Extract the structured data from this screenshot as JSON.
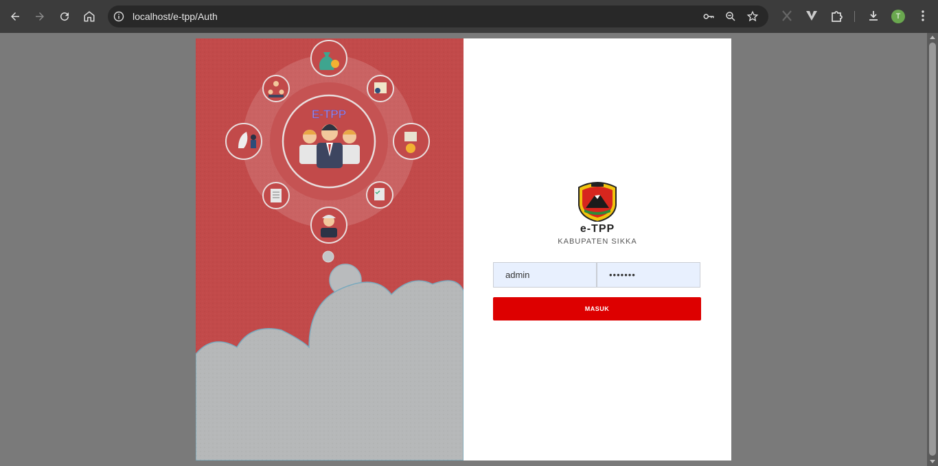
{
  "browser": {
    "url": "localhost/e-tpp/Auth",
    "profile_initial": "T",
    "icons": [
      "back-icon",
      "forward-icon",
      "reload-icon",
      "home-icon",
      "info-icon",
      "key-icon",
      "zoom-icon",
      "star-icon",
      "x-extension-icon",
      "vivaldi-extension-icon",
      "extensions-puzzle-icon",
      "download-icon",
      "menu-kebab-icon"
    ]
  },
  "illustration": {
    "center_label": "E-TPP"
  },
  "login": {
    "title": "e-TPP",
    "subtitle": "KABUPATEN SIKKA",
    "username_value": "admin",
    "password_value": "•••••••",
    "submit_label": "MASUK"
  },
  "colors": {
    "accent_red": "#dd0000",
    "panel_red": "#c24a4a",
    "cloud_grey": "#b6b8b9",
    "input_bg": "#e8f0fe"
  }
}
